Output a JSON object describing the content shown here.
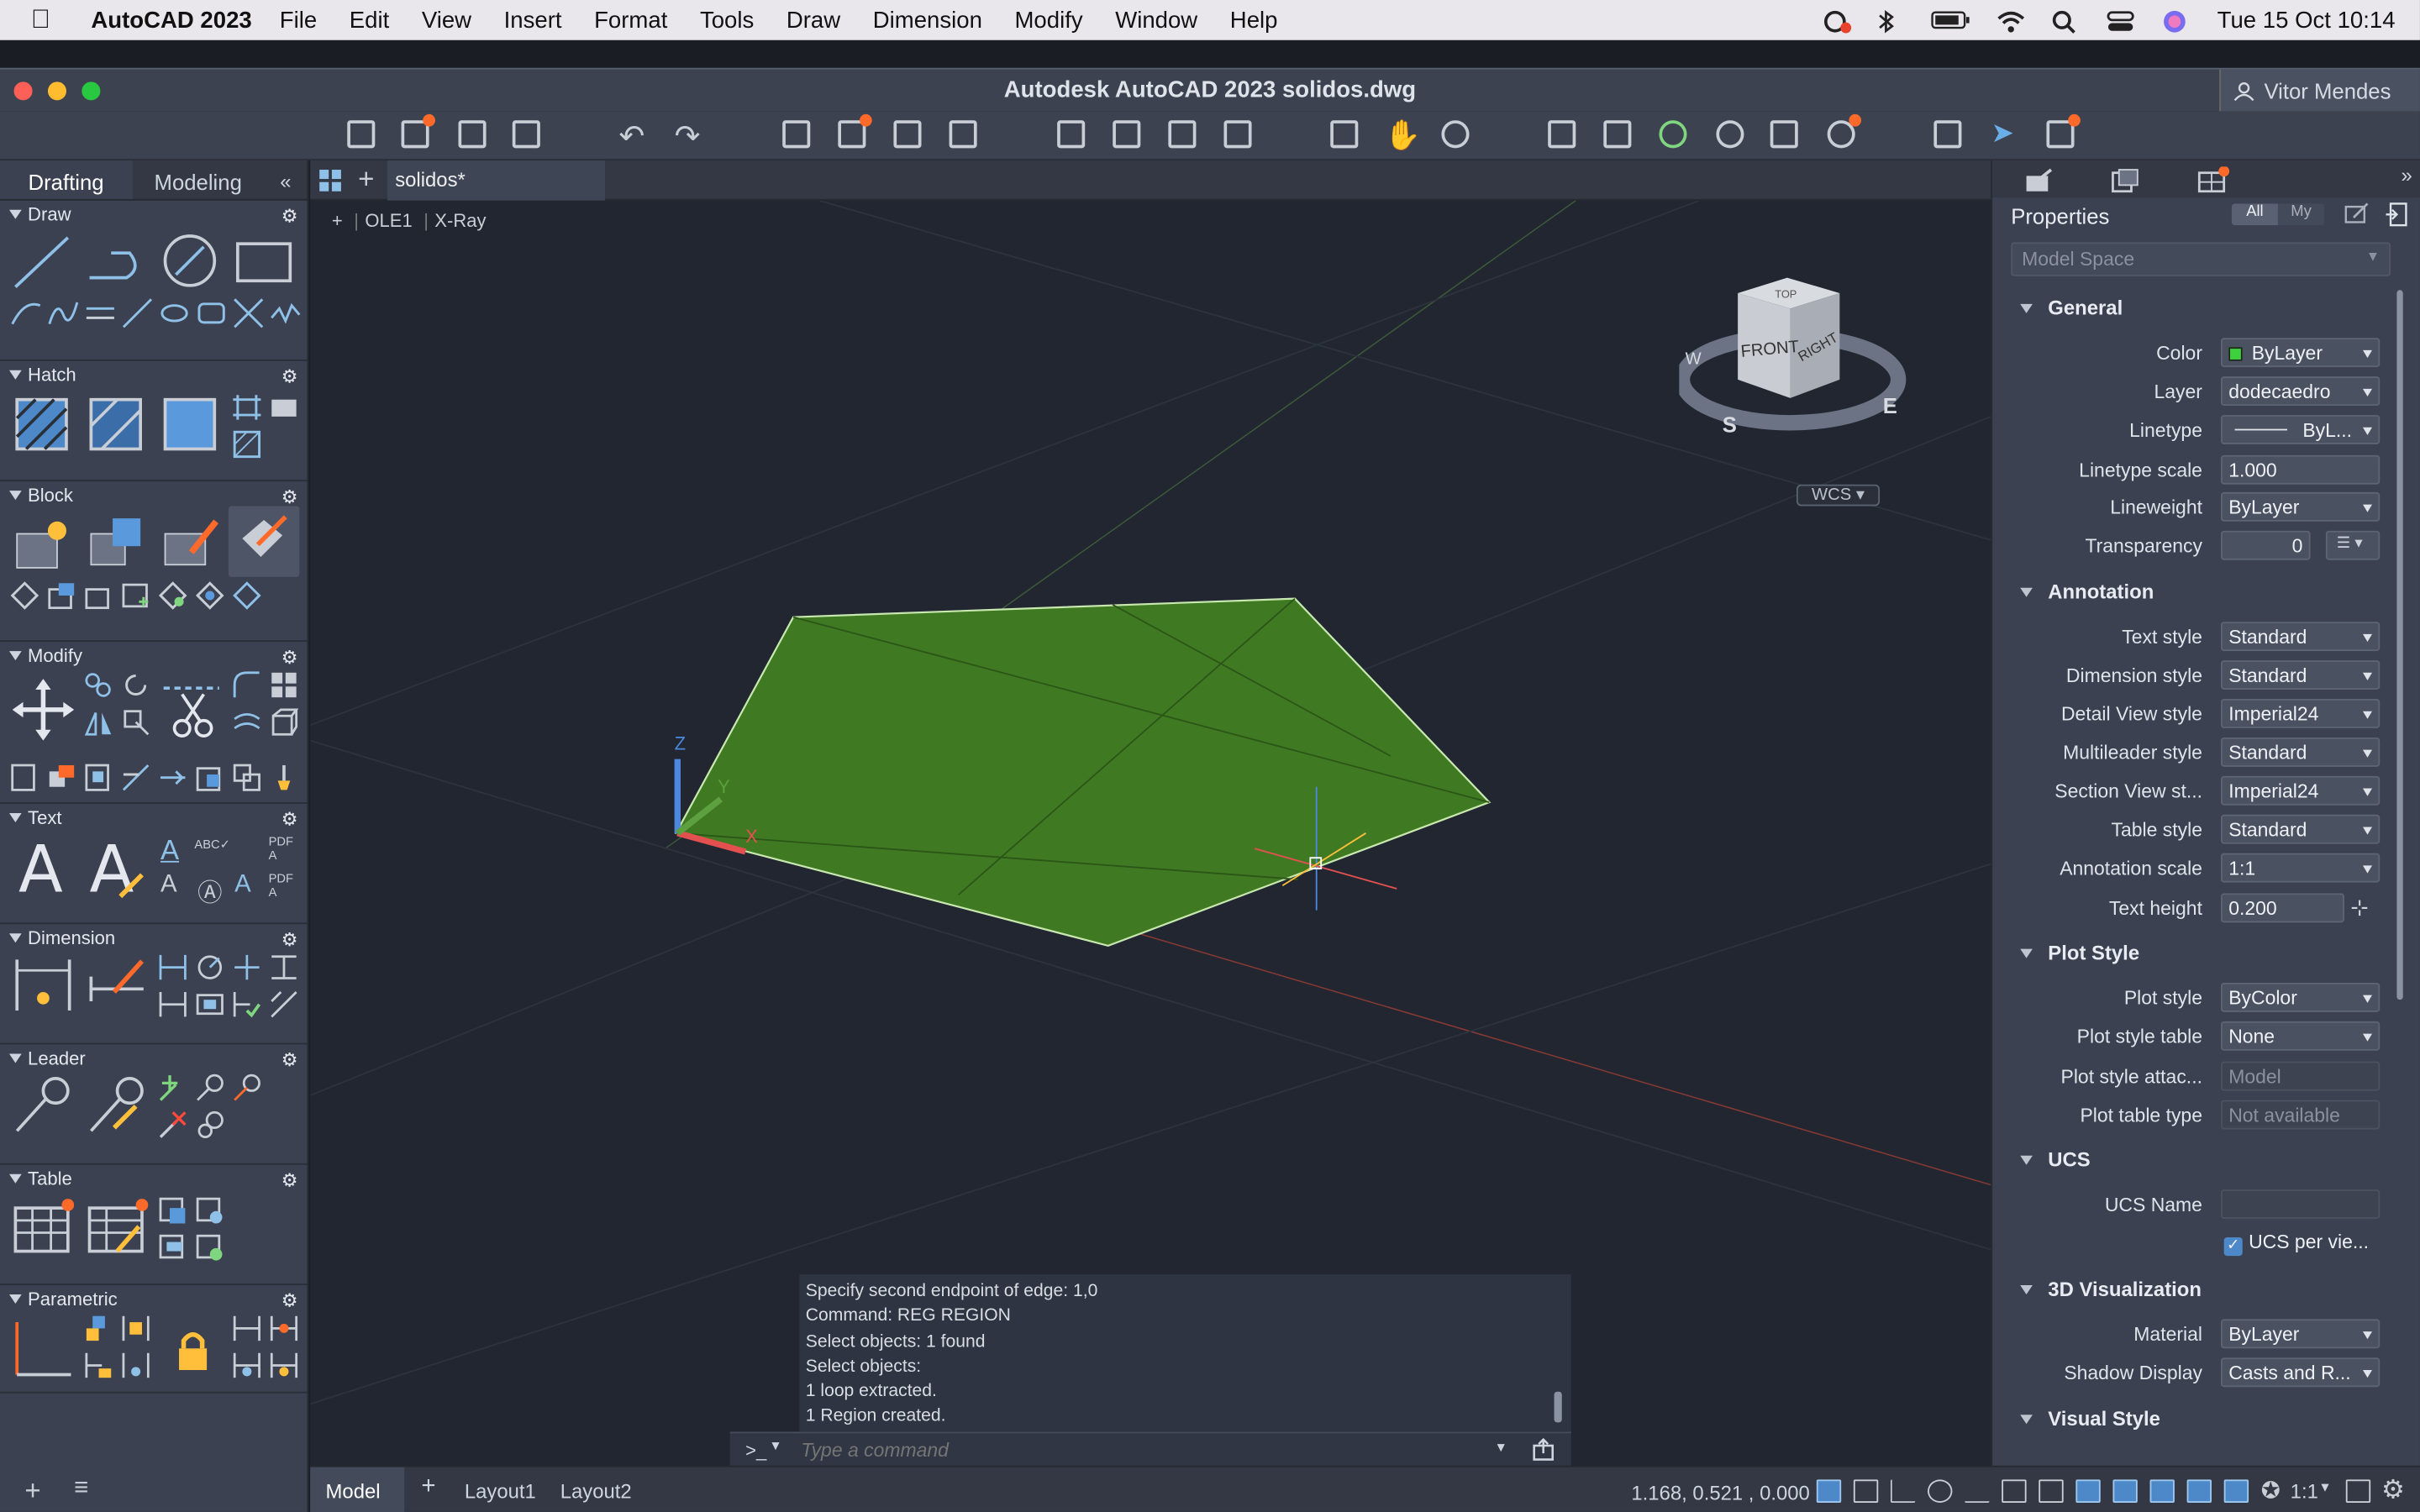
{
  "menubar": {
    "app_name": "AutoCAD 2023",
    "items": [
      "File",
      "Edit",
      "View",
      "Insert",
      "Format",
      "Tools",
      "Draw",
      "Dimension",
      "Modify",
      "Window",
      "Help"
    ],
    "clock": "Tue 15 Oct  10:14"
  },
  "window": {
    "title": "Autodesk AutoCAD 2023    solidos.dwg",
    "user": "Vitor Mendes"
  },
  "left_panel": {
    "tabs": [
      "Drafting",
      "Modeling"
    ],
    "collapse_glyph": "«",
    "sections": [
      "Draw",
      "Hatch",
      "Block",
      "Modify",
      "Text",
      "Dimension",
      "Leader",
      "Table",
      "Parametric"
    ]
  },
  "doc_tab": {
    "label": "solidos*"
  },
  "viewport": {
    "label_plus": "+",
    "view_label": "OLE1",
    "style_label": "X-Ray",
    "viewcube": {
      "top": "TOP",
      "front": "FRONT",
      "right": "RIGHT",
      "w": "W",
      "s": "S",
      "e": "E"
    },
    "wcs": "WCS",
    "axis_z": "Z",
    "axis_y": "Y",
    "axis_x": "X"
  },
  "command_history": [
    "Specify second endpoint of edge: 1,0",
    "Command: REG REGION",
    "Select objects: 1 found",
    "Select objects:",
    "1 loop extracted.",
    "1 Region created."
  ],
  "command_input": {
    "prompt": ">_",
    "placeholder": "Type a command"
  },
  "properties": {
    "title": "Properties",
    "filter_all": "All",
    "filter_my": "My",
    "space": "Model Space",
    "general": {
      "heading": "General",
      "rows": [
        {
          "label": "Color",
          "value": "ByLayer",
          "color": "#3dd13d"
        },
        {
          "label": "Layer",
          "value": "dodecaedro"
        },
        {
          "label": "Linetype",
          "value": "ByL..."
        },
        {
          "label": "Linetype scale",
          "value": "1.000"
        },
        {
          "label": "Lineweight",
          "value": "ByLayer"
        },
        {
          "label": "Transparency",
          "value": "0"
        }
      ]
    },
    "annotation": {
      "heading": "Annotation",
      "rows": [
        {
          "label": "Text style",
          "value": "Standard"
        },
        {
          "label": "Dimension style",
          "value": "Standard"
        },
        {
          "label": "Detail View style",
          "value": "Imperial24"
        },
        {
          "label": "Multileader style",
          "value": "Standard"
        },
        {
          "label": "Section View st...",
          "value": "Imperial24"
        },
        {
          "label": "Table style",
          "value": "Standard"
        },
        {
          "label": "Annotation scale",
          "value": "1:1"
        },
        {
          "label": "Text height",
          "value": "0.200"
        }
      ]
    },
    "plot_style": {
      "heading": "Plot Style",
      "rows": [
        {
          "label": "Plot style",
          "value": "ByColor"
        },
        {
          "label": "Plot style table",
          "value": "None"
        },
        {
          "label": "Plot style attac...",
          "value": "Model"
        },
        {
          "label": "Plot table type",
          "value": "Not available"
        }
      ]
    },
    "ucs": {
      "heading": "UCS",
      "rows": [
        {
          "label": "UCS Name",
          "value": ""
        }
      ],
      "per_viewport": "UCS per vie..."
    },
    "viz3d": {
      "heading": "3D Visualization",
      "rows": [
        {
          "label": "Material",
          "value": "ByLayer"
        },
        {
          "label": "Shadow Display",
          "value": "Casts and R..."
        }
      ]
    },
    "visual_style": {
      "heading": "Visual Style"
    }
  },
  "statusbar": {
    "tabs": [
      "Model",
      "Layout1",
      "Layout2"
    ],
    "add_glyph": "+",
    "coordinates": "1.168,  0.521 , 0.000",
    "scale": "1:1"
  },
  "colors": {
    "region_fill": "#3f7a22",
    "region_edge": "#c8e8b0",
    "accent": "#ff6a2b"
  }
}
